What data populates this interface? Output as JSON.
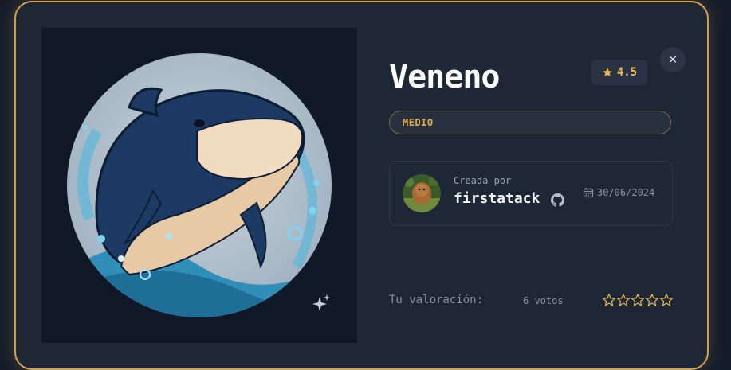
{
  "challenge": {
    "title": "Veneno",
    "rating": "4.5",
    "difficulty": "MEDIO"
  },
  "author": {
    "created_label": "Creada por",
    "name": "firstatack",
    "date": "30/06/2024"
  },
  "user_rating": {
    "label": "Tu valoración:",
    "votes": "6 votos",
    "stars_total": 5,
    "stars_selected": 0
  },
  "icons": {
    "close": "close-icon",
    "rating": "star-icon",
    "github": "github-icon",
    "calendar": "calendar-icon",
    "sparkle": "sparkle-icon"
  },
  "colors": {
    "accent": "#d3a250",
    "star": "#e9b84a",
    "background": "#1e2736"
  }
}
